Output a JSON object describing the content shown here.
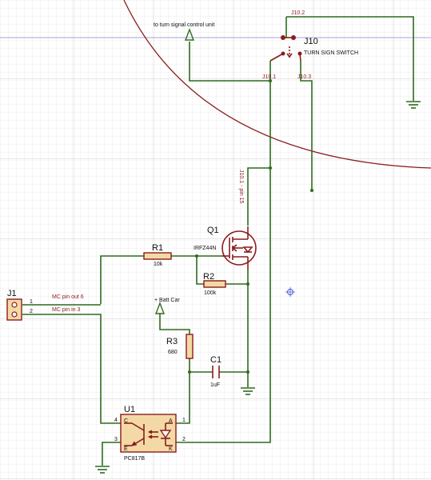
{
  "labels": {
    "signal_control": "to turn signal control unit",
    "batt_car": "+ Batt Car",
    "mc_pin_out_6": "MC pin out 6",
    "mc_pin_in_3": "MC pin in 3",
    "net_j10_1_pin15": "J10.1 - pin 15",
    "net_j10_2": "J10.2",
    "net_j10_1": "J10.1",
    "net_j10_3": "J10.3"
  },
  "components": {
    "j10": {
      "ref": "J10",
      "value": "TURN SIGN SWITCH"
    },
    "q1": {
      "ref": "Q1",
      "value": "IRFZ44N"
    },
    "r1": {
      "ref": "R1",
      "value": "10k"
    },
    "r2": {
      "ref": "R2",
      "value": "100k"
    },
    "r3": {
      "ref": "R3",
      "value": "680"
    },
    "c1": {
      "ref": "C1",
      "value": "1uF"
    },
    "u1": {
      "ref": "U1",
      "value": "PC817B"
    },
    "j1": {
      "ref": "J1",
      "value": ""
    }
  },
  "pins": {
    "j1_1": "1",
    "j1_2": "2",
    "u1_4": "4",
    "u1_3": "3",
    "u1_1": "1",
    "u1_2": "2",
    "u1_c": "C",
    "u1_e": "E",
    "u1_a": "A",
    "u1_k": "K"
  },
  "colors": {
    "wire": "#2f6b1f",
    "component": "#8b1c1c",
    "component_fill": "#f3d9a6",
    "grid_minor": "#e6e6e6",
    "grid_major": "#c8c8c8",
    "board_edge": "#8b1c1c",
    "cursor_line": "#7777cc"
  }
}
